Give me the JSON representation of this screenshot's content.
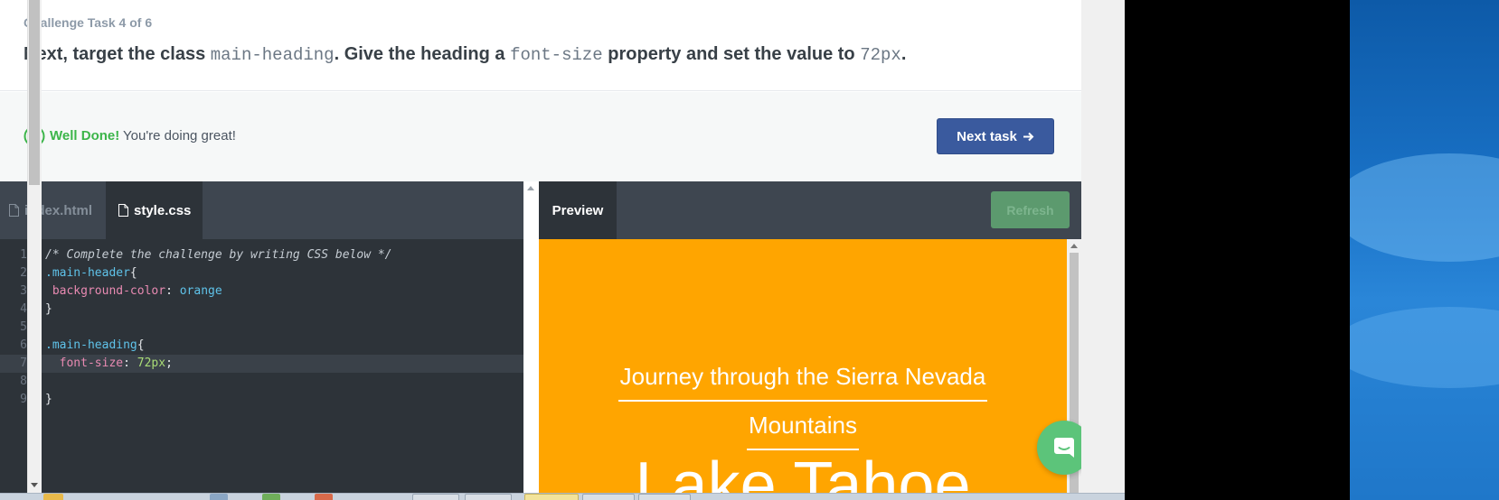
{
  "task": {
    "count_label": "Challenge Task 4 of 6",
    "text_part1": "Next, target the class ",
    "code1": "main-heading",
    "text_part2": ". Give the heading a ",
    "code2": "font-size",
    "text_part3": " property and set the value to ",
    "code3": "72px",
    "text_part4": "."
  },
  "status": {
    "title": "Well Done!",
    "message": "You're doing great!",
    "next_button_label": "Next task",
    "colors": {
      "success": "#3cb54a",
      "primary": "#3a5a9e"
    }
  },
  "editor": {
    "tabs": [
      {
        "label": "index.html",
        "active": false
      },
      {
        "label": "style.css",
        "active": true
      }
    ],
    "lines": [
      {
        "n": "1",
        "comment": "/* Complete the challenge by writing CSS below */"
      },
      {
        "n": "2",
        "sel": ".main-header",
        "pun": "{"
      },
      {
        "n": "3",
        "prop": " background-color",
        "pun": ": ",
        "val": "orange"
      },
      {
        "n": "4",
        "pun": "}"
      },
      {
        "n": "5"
      },
      {
        "n": "6",
        "sel": ".main-heading",
        "pun": "{"
      },
      {
        "n": "7",
        "prop": "  font-size",
        "pun": ": ",
        "num": "72px",
        "end": ";"
      },
      {
        "n": "8"
      },
      {
        "n": "9",
        "pun": "}"
      }
    ]
  },
  "preview": {
    "tab_label": "Preview",
    "refresh_label": "Refresh",
    "heading_line1": "Journey through the Sierra Nevada",
    "heading_line2": "Mountains",
    "big_heading": "Lake Tahoe",
    "background_color": "#ffa500"
  }
}
